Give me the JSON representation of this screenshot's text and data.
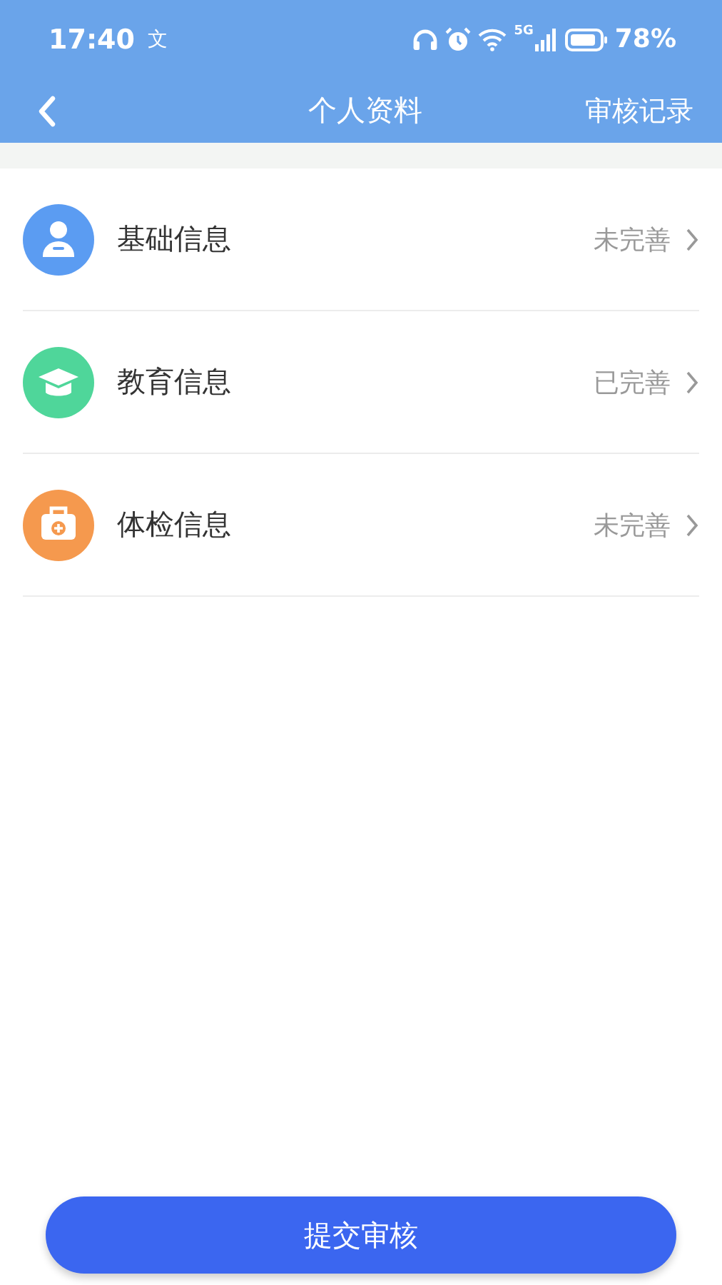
{
  "status_bar": {
    "time": "17:40",
    "notification": "文",
    "network": "5G",
    "battery": "78%"
  },
  "nav": {
    "title": "个人资料",
    "action": "审核记录"
  },
  "items": [
    {
      "kind": "person",
      "color": "#5b9cf2",
      "label": "基础信息",
      "status": "未完善"
    },
    {
      "kind": "cap",
      "color": "#4fd69a",
      "label": "教育信息",
      "status": "已完善"
    },
    {
      "kind": "medkit",
      "color": "#f5994e",
      "label": "体检信息",
      "status": "未完善"
    }
  ],
  "submit": "提交审核"
}
